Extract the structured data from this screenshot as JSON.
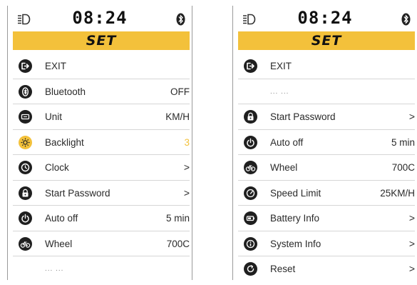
{
  "colors": {
    "accent": "#f3c13b",
    "icon_dark": "#1f1f1f",
    "divider": "#d6d6d6"
  },
  "left": {
    "time": "08:24",
    "title": "SET",
    "items": [
      {
        "label": "EXIT",
        "value": "",
        "icon": "exit-icon"
      },
      {
        "label": "Bluetooth",
        "value": "OFF",
        "icon": "bluetooth-icon"
      },
      {
        "label": "Unit",
        "value": "KM/H",
        "icon": "unit-icon"
      },
      {
        "label": "Backlight",
        "value": "3",
        "icon": "backlight-icon"
      },
      {
        "label": "Clock",
        "value": ">",
        "icon": "clock-icon"
      },
      {
        "label": "Start Password",
        "value": ">",
        "icon": "lock-icon"
      },
      {
        "label": "Auto off",
        "value": "5 min",
        "icon": "power-icon"
      },
      {
        "label": "Wheel",
        "value": "700C",
        "icon": "bicycle-icon"
      }
    ],
    "more": "... ..."
  },
  "right": {
    "time": "08:24",
    "title": "SET",
    "exit_label": "EXIT",
    "more": "... ...",
    "items": [
      {
        "label": "Start Password",
        "value": ">",
        "icon": "lock-icon"
      },
      {
        "label": "Auto off",
        "value": "5 min",
        "icon": "power-icon"
      },
      {
        "label": "Wheel",
        "value": "700C",
        "icon": "bicycle-icon"
      },
      {
        "label": "Speed Limit",
        "value": "25KM/H",
        "icon": "speedometer-icon"
      },
      {
        "label": "Battery Info",
        "value": ">",
        "icon": "battery-info-icon"
      },
      {
        "label": "System Info",
        "value": ">",
        "icon": "info-icon"
      },
      {
        "label": "Reset",
        "value": ">",
        "icon": "reset-icon"
      }
    ]
  }
}
